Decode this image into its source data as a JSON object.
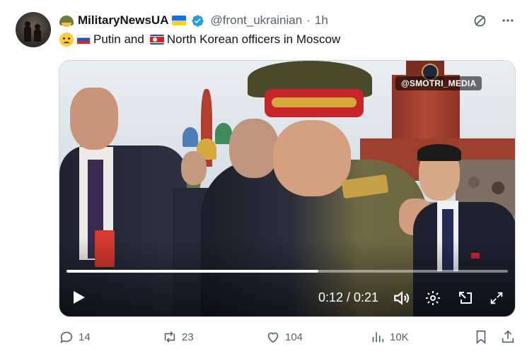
{
  "tweet": {
    "author_name": "MilitaryNewsUA",
    "handle": "@front_ukrainian",
    "separator": "·",
    "time_ago": "1h",
    "text_part1": "Putin and",
    "text_part2": "North Korean officers in Moscow"
  },
  "video": {
    "watermark": "@SMOTRI_MEDIA",
    "time_display": "0:12 / 0:21",
    "progress_fraction": 0.57
  },
  "actions": {
    "replies": "14",
    "reposts": "23",
    "likes": "104",
    "views": "10K"
  },
  "colors": {
    "text_primary": "#0f1419",
    "text_secondary": "#536471",
    "verified": "#1d9bf0"
  },
  "icons": {
    "grok": "grok-icon",
    "more": "more-icon",
    "reply": "reply-icon",
    "repost": "repost-icon",
    "like": "like-icon",
    "views": "views-icon",
    "bookmark": "bookmark-icon",
    "share": "share-icon"
  }
}
